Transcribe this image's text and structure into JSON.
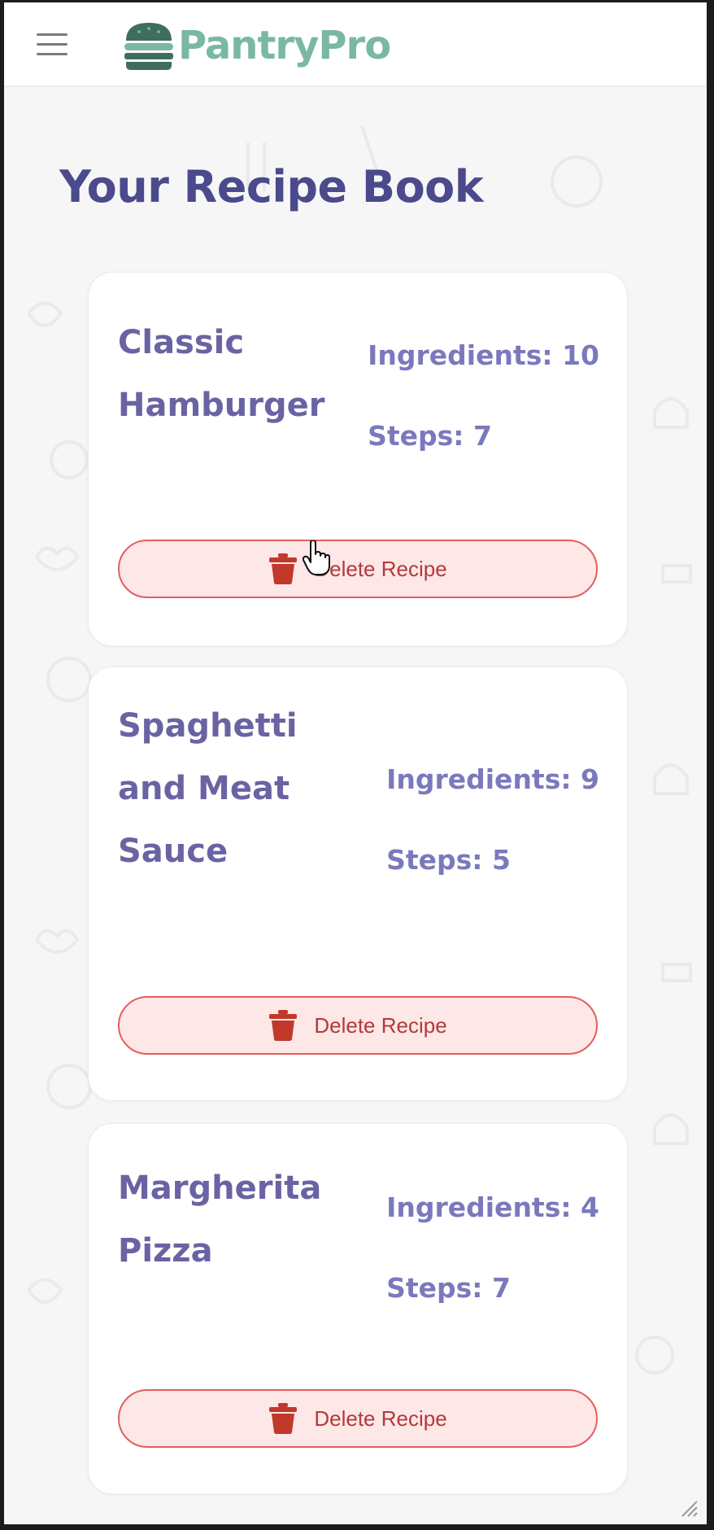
{
  "header": {
    "app_name": "PantryPro"
  },
  "page": {
    "title": "Your Recipe Book"
  },
  "recipes": [
    {
      "name": "Classic Hamburger",
      "ingredients_text": "Ingredients: 10",
      "steps_text": "Steps: 7",
      "delete_label": "Delete Recipe"
    },
    {
      "name": "Spaghetti and Meat Sauce",
      "ingredients_text": "Ingredients: 9",
      "steps_text": "Steps: 5",
      "delete_label": "Delete Recipe"
    },
    {
      "name": "Margherita Pizza",
      "ingredients_text": "Ingredients: 4",
      "steps_text": "Steps: 7",
      "delete_label": "Delete Recipe"
    }
  ],
  "colors": {
    "brand": "#7ab8a3",
    "brand_dark": "#3f6e5f",
    "title": "#4a4a8c",
    "recipe_name": "#6a63a3",
    "meta": "#7b79bd",
    "danger": "#c0392b",
    "danger_bg": "#fde7e7"
  },
  "icons": {
    "menu": "hamburger-menu-icon",
    "logo": "burger-logo-icon",
    "delete": "trash-icon",
    "cursor": "hand-pointer-icon"
  }
}
